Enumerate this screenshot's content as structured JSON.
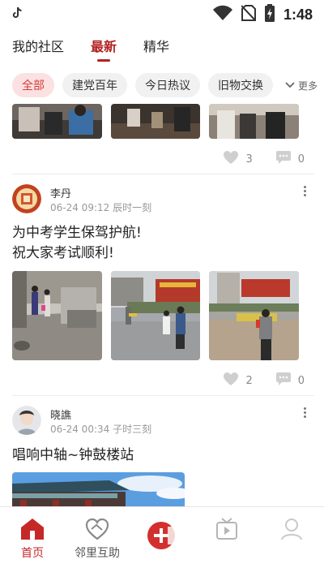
{
  "status_bar": {
    "time": "1:48",
    "app_icon": "tiktok-icon",
    "icons": [
      "wifi-icon",
      "no-sim-icon",
      "battery-charging-icon"
    ]
  },
  "top_tabs": [
    {
      "label": "我的社区",
      "active": false
    },
    {
      "label": "最新",
      "active": true
    },
    {
      "label": "精华",
      "active": false
    }
  ],
  "chips": [
    {
      "label": "全部",
      "active": true
    },
    {
      "label": "建党百年",
      "active": false
    },
    {
      "label": "今日热议",
      "active": false
    },
    {
      "label": "旧物交换",
      "active": false
    }
  ],
  "more_label": "更多",
  "posts": [
    {
      "likes": "3",
      "comments": "0"
    },
    {
      "username": "李丹",
      "date": "06-24 09:12",
      "period": "辰时一刻",
      "text_lines": [
        "为中考学生保驾护航!",
        "祝大家考试顺利!"
      ],
      "likes": "2",
      "comments": "0"
    },
    {
      "username": "晓譙",
      "date": "06-24 00:34",
      "period": "子时三刻",
      "text_lines": [
        "唱响中轴~钟鼓楼站"
      ]
    }
  ],
  "bottom_nav": [
    {
      "label": "首页",
      "icon": "home-icon",
      "active": true
    },
    {
      "label": "邻里互助",
      "icon": "heart-hands-icon",
      "active": false
    },
    {
      "label": "",
      "icon": "add-post-icon",
      "active": false
    },
    {
      "label": "",
      "icon": "video-icon",
      "active": false
    },
    {
      "label": "",
      "icon": "profile-icon",
      "active": false
    }
  ],
  "colors": {
    "accent": "#c62828",
    "chip_active_bg": "#fbe1e1",
    "chip_bg": "#f1f1f1"
  }
}
